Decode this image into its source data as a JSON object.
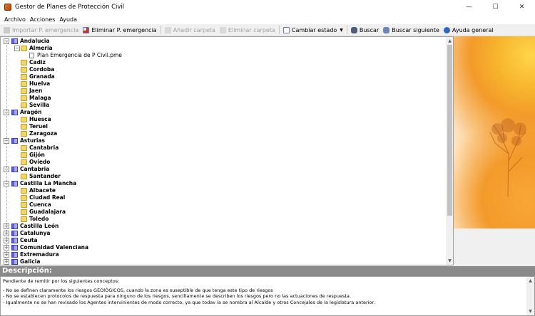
{
  "window": {
    "title": "Gestor de Planes de Protección Civil",
    "minimize": "—",
    "maximize": "☐",
    "close": "✕"
  },
  "menu": [
    "Archivo",
    "Acciones",
    "Ayuda"
  ],
  "toolbar": {
    "import_label": "Importar P. emergencia",
    "delete_label": "Eliminar P. emergencia",
    "add_folder_label": "Añadir carpeta",
    "delete_folder_label": "Eliminar carpeta",
    "change_state_label": "Cambiar estado",
    "search_label": "Buscar",
    "search_next_label": "Buscar siguiente",
    "help_label": "Ayuda general"
  },
  "tree": [
    {
      "label": "Andalucia",
      "level": 0,
      "type": "region",
      "expanded": true
    },
    {
      "label": "Almeria",
      "level": 1,
      "type": "folder",
      "expanded": true
    },
    {
      "label": "Plan Emergencia de P Civil.pme",
      "level": 2,
      "type": "file"
    },
    {
      "label": "Cadiz",
      "level": 1,
      "type": "folder"
    },
    {
      "label": "Cordoba",
      "level": 1,
      "type": "folder"
    },
    {
      "label": "Granada",
      "level": 1,
      "type": "folder"
    },
    {
      "label": "Huelva",
      "level": 1,
      "type": "folder"
    },
    {
      "label": "Jaen",
      "level": 1,
      "type": "folder"
    },
    {
      "label": "Malaga",
      "level": 1,
      "type": "folder"
    },
    {
      "label": "Sevilla",
      "level": 1,
      "type": "folder"
    },
    {
      "label": "Aragón",
      "level": 0,
      "type": "region",
      "expanded": true
    },
    {
      "label": "Huesca",
      "level": 1,
      "type": "folder"
    },
    {
      "label": "Teruel",
      "level": 1,
      "type": "folder"
    },
    {
      "label": "Zaragoza",
      "level": 1,
      "type": "folder"
    },
    {
      "label": "Asturias",
      "level": 0,
      "type": "region",
      "expanded": true
    },
    {
      "label": "Cantabria",
      "level": 1,
      "type": "folder"
    },
    {
      "label": "Gijón",
      "level": 1,
      "type": "folder"
    },
    {
      "label": "Oviedo",
      "level": 1,
      "type": "folder"
    },
    {
      "label": "Cantabria",
      "level": 0,
      "type": "region",
      "expanded": true
    },
    {
      "label": "Santander",
      "level": 1,
      "type": "folder"
    },
    {
      "label": "Castilla La Mancha",
      "level": 0,
      "type": "region",
      "expanded": true
    },
    {
      "label": "Albacete",
      "level": 1,
      "type": "folder"
    },
    {
      "label": "Ciudad Real",
      "level": 1,
      "type": "folder"
    },
    {
      "label": "Cuenca",
      "level": 1,
      "type": "folder"
    },
    {
      "label": "Guadalajara",
      "level": 1,
      "type": "folder"
    },
    {
      "label": "Toledo",
      "level": 1,
      "type": "folder"
    },
    {
      "label": "Castilla León",
      "level": 0,
      "type": "region",
      "expanded": false
    },
    {
      "label": "Catalunya",
      "level": 0,
      "type": "region",
      "expanded": false
    },
    {
      "label": "Ceuta",
      "level": 0,
      "type": "region",
      "expanded": false
    },
    {
      "label": "Comunidad Valenciana",
      "level": 0,
      "type": "region",
      "expanded": false
    },
    {
      "label": "Extremadura",
      "level": 0,
      "type": "region",
      "expanded": false
    },
    {
      "label": "Galicia",
      "level": 0,
      "type": "region",
      "expanded": false
    }
  ],
  "description": {
    "header": "Descripción:",
    "lines": [
      "Pendiente de remitir por los siguientes conceptos:",
      "",
      "- No se definen claramente los riesgos GEOlÓGICOS, cuando la zona es suseptible de que tenga este tipo de riesgos",
      "- No se establecen protocolos de respuesta para ninguno de los riesgos, sencillamente se describen los riesgos pero no las actuaciones de respuesta.",
      "- Igualmente no se han revisado los Agentes intervinientes de modo correcto, ya que todav ía se nombra al Alcalde y otros Concejales de la legislatura anterior."
    ]
  }
}
